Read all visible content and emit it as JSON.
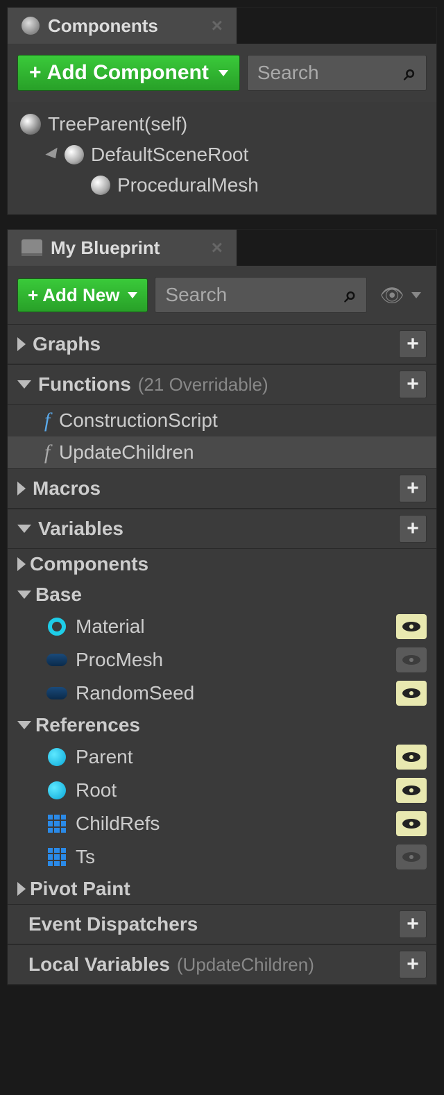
{
  "components_panel": {
    "title": "Components",
    "add_button": "Add Component",
    "search_placeholder": "Search",
    "tree": {
      "root": "TreeParent(self)",
      "scene_root": "DefaultSceneRoot",
      "child": "ProceduralMesh"
    }
  },
  "blueprint_panel": {
    "title": "My Blueprint",
    "add_button": "Add New",
    "search_placeholder": "Search",
    "categories": {
      "graphs": {
        "label": "Graphs"
      },
      "functions": {
        "label": "Functions",
        "count": "(21 Overridable)",
        "items": [
          "ConstructionScript",
          "UpdateChildren"
        ]
      },
      "macros": {
        "label": "Macros"
      },
      "variables": {
        "label": "Variables",
        "groups": {
          "components": "Components",
          "base": {
            "label": "Base",
            "items": [
              "Material",
              "ProcMesh",
              "RandomSeed"
            ]
          },
          "references": {
            "label": "References",
            "items": [
              "Parent",
              "Root",
              "ChildRefs",
              "Ts"
            ]
          },
          "pivot_paint": "Pivot Paint"
        }
      },
      "event_dispatchers": {
        "label": "Event Dispatchers"
      },
      "local_variables": {
        "label": "Local Variables",
        "context": "(UpdateChildren)"
      }
    }
  }
}
